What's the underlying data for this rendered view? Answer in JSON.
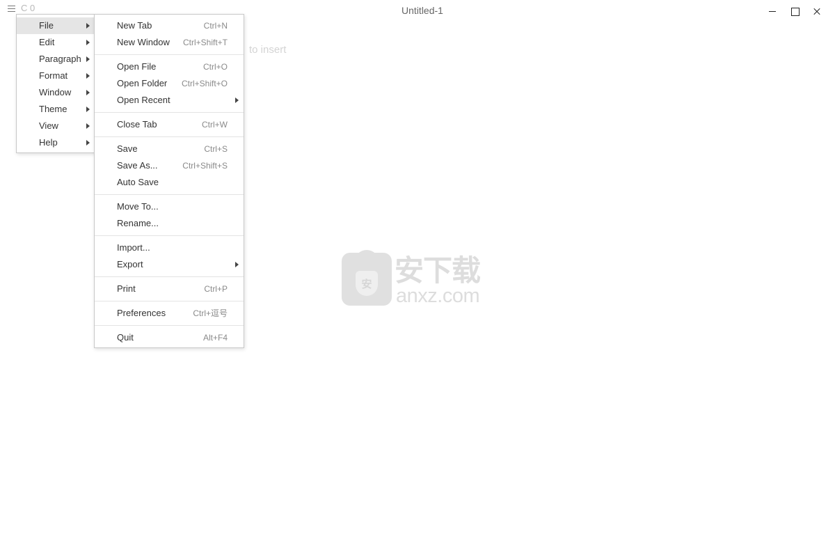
{
  "titlebar": {
    "word_count": "C 0",
    "title": "Untitled-1"
  },
  "editor": {
    "placeholder_fragment": "to insert"
  },
  "main_menu": {
    "items": [
      {
        "label": "File"
      },
      {
        "label": "Edit"
      },
      {
        "label": "Paragraph"
      },
      {
        "label": "Format"
      },
      {
        "label": "Window"
      },
      {
        "label": "Theme"
      },
      {
        "label": "View"
      },
      {
        "label": "Help"
      }
    ]
  },
  "file_menu": {
    "items": [
      {
        "label": "New Tab",
        "shortcut": "Ctrl+N"
      },
      {
        "label": "New Window",
        "shortcut": "Ctrl+Shift+T"
      },
      {
        "label": "Open File",
        "shortcut": "Ctrl+O"
      },
      {
        "label": "Open Folder",
        "shortcut": "Ctrl+Shift+O"
      },
      {
        "label": "Open Recent"
      },
      {
        "label": "Close Tab",
        "shortcut": "Ctrl+W"
      },
      {
        "label": "Save",
        "shortcut": "Ctrl+S"
      },
      {
        "label": "Save As...",
        "shortcut": "Ctrl+Shift+S"
      },
      {
        "label": "Auto Save"
      },
      {
        "label": "Move To..."
      },
      {
        "label": "Rename..."
      },
      {
        "label": "Import..."
      },
      {
        "label": "Export"
      },
      {
        "label": "Print",
        "shortcut": "Ctrl+P"
      },
      {
        "label": "Preferences",
        "shortcut": "Ctrl+逗号"
      },
      {
        "label": "Quit",
        "shortcut": "Alt+F4"
      }
    ]
  },
  "watermark": {
    "shield_text": "安",
    "cn_text": "安下载",
    "en_text": "anxz.com"
  },
  "icons": {
    "menu": "hamburger-icon",
    "minimize": "minimize-icon",
    "maximize": "maximize-icon",
    "close": "close-icon",
    "submenu": "chevron-right-icon"
  }
}
